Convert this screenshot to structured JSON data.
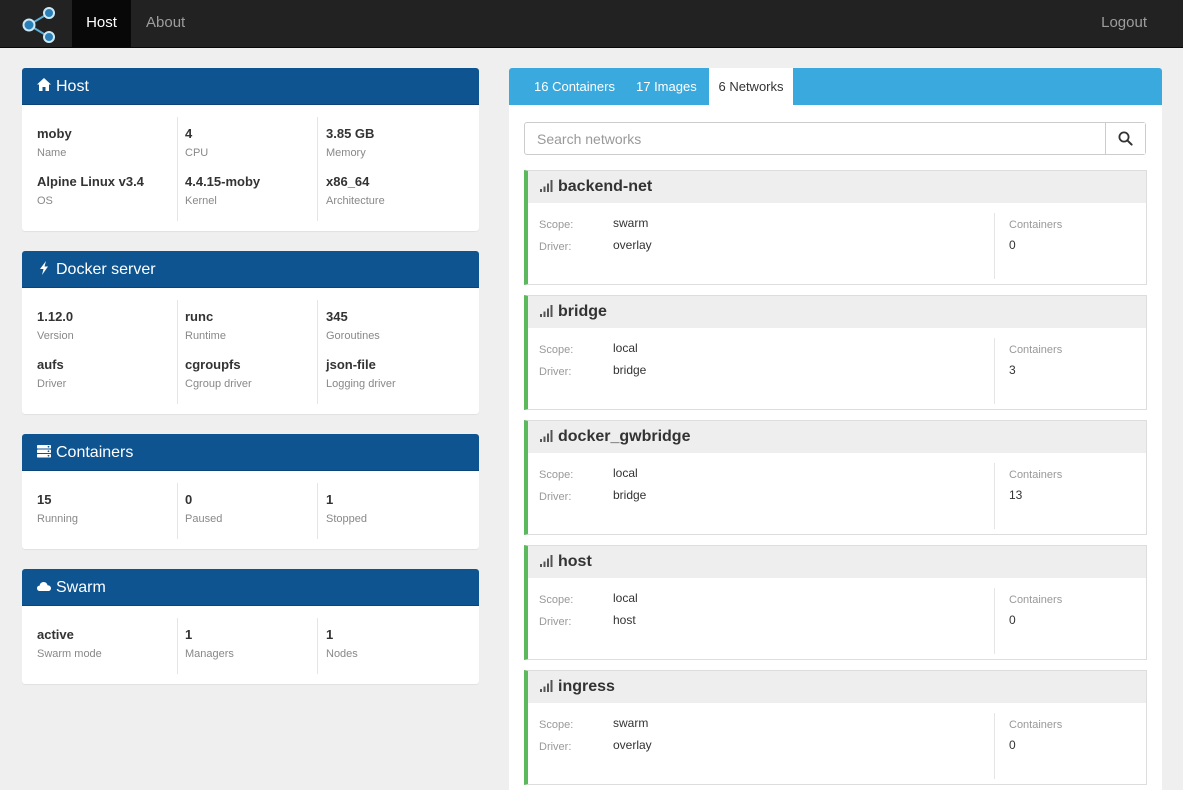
{
  "nav": {
    "host": "Host",
    "about": "About",
    "logout": "Logout"
  },
  "host_panel": {
    "title": "Host",
    "name": {
      "value": "moby",
      "label": "Name"
    },
    "cpu": {
      "value": "4",
      "label": "CPU"
    },
    "memory": {
      "value": "3.85 GB",
      "label": "Memory"
    },
    "os": {
      "value": "Alpine Linux v3.4",
      "label": "OS"
    },
    "kernel": {
      "value": "4.4.15-moby",
      "label": "Kernel"
    },
    "arch": {
      "value": "x86_64",
      "label": "Architecture"
    }
  },
  "docker_panel": {
    "title": "Docker server",
    "version": {
      "value": "1.12.0",
      "label": "Version"
    },
    "runtime": {
      "value": "runc",
      "label": "Runtime"
    },
    "goroutines": {
      "value": "345",
      "label": "Goroutines"
    },
    "driver": {
      "value": "aufs",
      "label": "Driver"
    },
    "cgroup": {
      "value": "cgroupfs",
      "label": "Cgroup driver"
    },
    "logging": {
      "value": "json-file",
      "label": "Logging driver"
    }
  },
  "containers_panel": {
    "title": "Containers",
    "running": {
      "value": "15",
      "label": "Running"
    },
    "paused": {
      "value": "0",
      "label": "Paused"
    },
    "stopped": {
      "value": "1",
      "label": "Stopped"
    }
  },
  "swarm_panel": {
    "title": "Swarm",
    "mode": {
      "value": "active",
      "label": "Swarm mode"
    },
    "managers": {
      "value": "1",
      "label": "Managers"
    },
    "nodes": {
      "value": "1",
      "label": "Nodes"
    }
  },
  "tabs": {
    "containers": "16 Containers",
    "images": "17 Images",
    "networks": "6 Networks"
  },
  "search": {
    "placeholder": "Search networks"
  },
  "labels": {
    "scope": "Scope:",
    "driver": "Driver:",
    "containers": "Containers"
  },
  "networks": [
    {
      "name": "backend-net",
      "scope": "swarm",
      "driver": "overlay",
      "containers": "0"
    },
    {
      "name": "bridge",
      "scope": "local",
      "driver": "bridge",
      "containers": "3"
    },
    {
      "name": "docker_gwbridge",
      "scope": "local",
      "driver": "bridge",
      "containers": "13"
    },
    {
      "name": "host",
      "scope": "local",
      "driver": "host",
      "containers": "0"
    },
    {
      "name": "ingress",
      "scope": "swarm",
      "driver": "overlay",
      "containers": "0"
    }
  ],
  "colors": {
    "panel_header": "#0e5491",
    "tab_bar": "#3aa9de",
    "network_accent": "#5cb85c",
    "navbar": "#222222"
  }
}
